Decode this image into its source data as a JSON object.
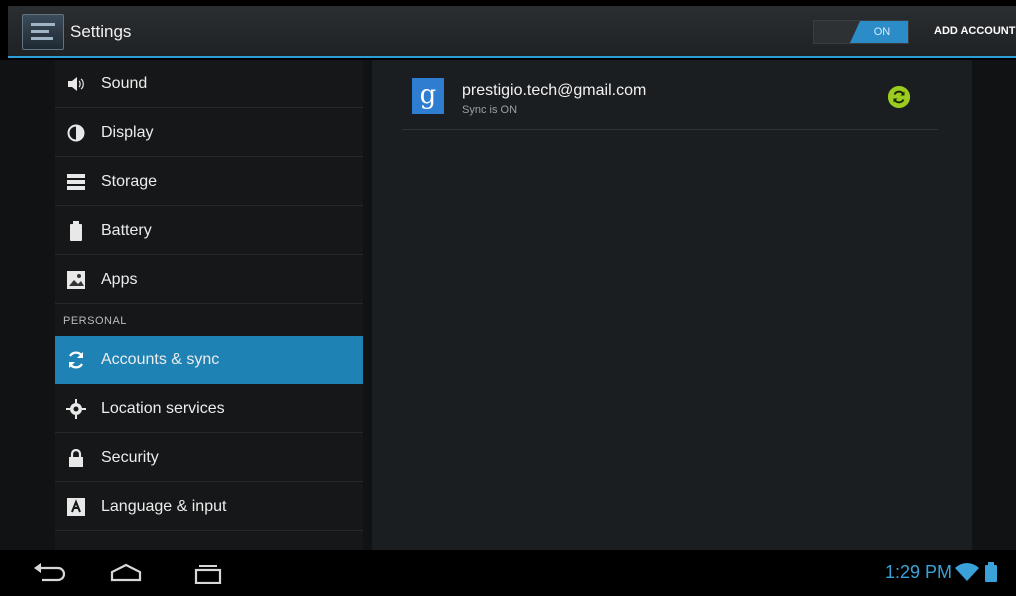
{
  "actionbar": {
    "title": "Settings",
    "toggle_label": "ON",
    "add_account_label": "ADD ACCOUNT"
  },
  "sidebar": {
    "items_top": [
      {
        "label": "Sound",
        "icon": "speaker-icon"
      },
      {
        "label": "Display",
        "icon": "brightness-icon"
      },
      {
        "label": "Storage",
        "icon": "storage-icon"
      },
      {
        "label": "Battery",
        "icon": "battery-icon"
      },
      {
        "label": "Apps",
        "icon": "apps-icon"
      }
    ],
    "section_personal": "PERSONAL",
    "items_personal": [
      {
        "label": "Accounts & sync",
        "icon": "sync-icon",
        "selected": true
      },
      {
        "label": "Location services",
        "icon": "location-icon"
      },
      {
        "label": "Security",
        "icon": "lock-icon"
      },
      {
        "label": "Language & input",
        "icon": "language-icon"
      }
    ]
  },
  "account": {
    "email": "prestigio.tech@gmail.com",
    "status": "Sync is ON",
    "icon": "google-icon",
    "sync_color": "#9ccc1f"
  },
  "status_bar": {
    "time": "1:29 PM"
  },
  "colors": {
    "accent": "#2c9fd6",
    "selected": "#1f82b4"
  }
}
